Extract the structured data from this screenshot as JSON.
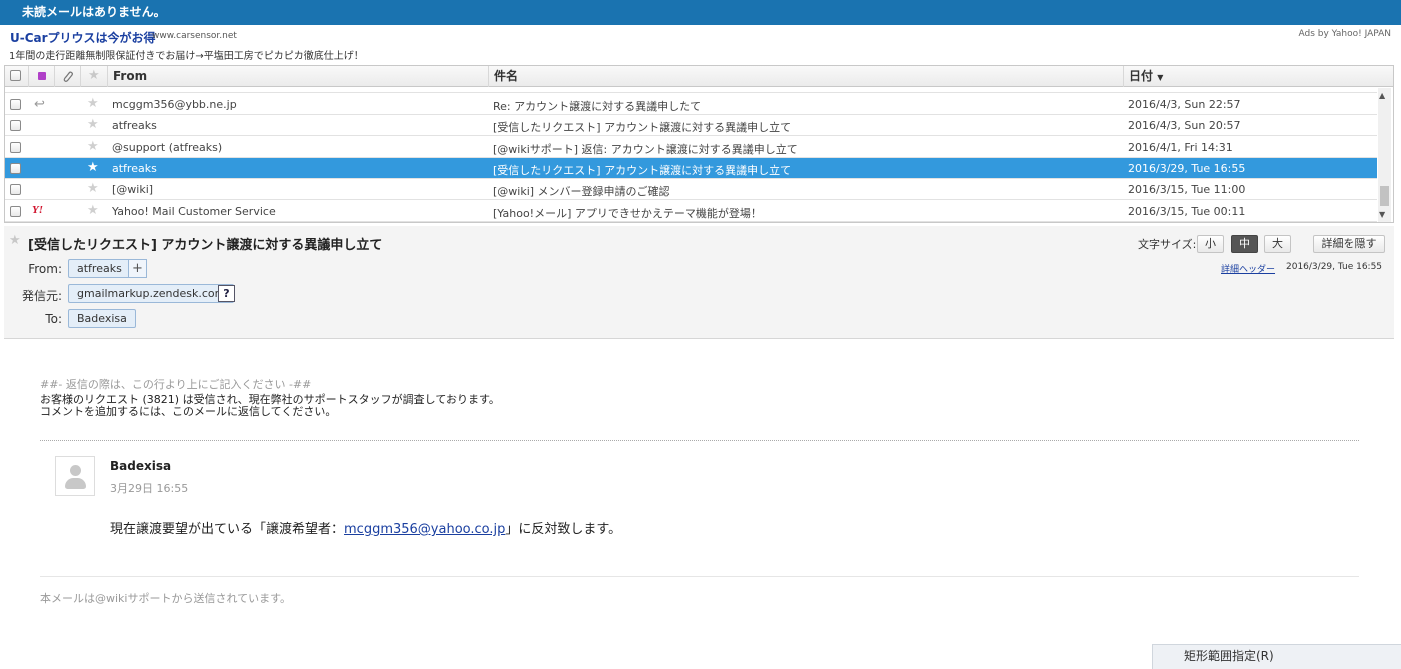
{
  "topbar": {
    "notice": "未読メールはありません。"
  },
  "ad": {
    "title": "U-Carプリウスは今がお得",
    "url": "www.carsensor.net",
    "description": "1年間の走行距離無制限保証付きでお届け→平塩田工房でピカピカ徹底仕上げ！",
    "ads_by": "Ads by Yahoo! JAPAN"
  },
  "list": {
    "columns": {
      "from": "From",
      "subject": "件名",
      "date": "日付",
      "sort_indicator": "▼"
    },
    "rows": [
      {
        "from": "mcggm356@ybb.ne.jp",
        "subject": "Re: アカウント譲渡に対する異議申したて",
        "date": "2016/4/3, Sun 22:57",
        "icon": "reply-icon",
        "selected": false
      },
      {
        "from": "atfreaks",
        "subject": "[受信したリクエスト] アカウント譲渡に対する異議申し立て",
        "date": "2016/4/3, Sun 20:57",
        "icon": "",
        "selected": false
      },
      {
        "from": "@support (atfreaks)",
        "subject": "[@wikiサポート] 返信: アカウント譲渡に対する異議申し立て",
        "date": "2016/4/1, Fri 14:31",
        "icon": "",
        "selected": false
      },
      {
        "from": "atfreaks",
        "subject": "[受信したリクエスト] アカウント譲渡に対する異議申し立て",
        "date": "2016/3/29, Tue 16:55",
        "icon": "",
        "selected": true
      },
      {
        "from": "[@wiki]",
        "subject": "[@wiki] メンバー登録申請のご確認",
        "date": "2016/3/15, Tue 11:00",
        "icon": "",
        "selected": false
      },
      {
        "from": "Yahoo! Mail Customer Service",
        "subject": "[Yahoo!メール] アプリできせかえテーマ機能が登場！",
        "date": "2016/3/15, Tue 00:11",
        "icon": "yahoo-icon",
        "selected": false
      }
    ]
  },
  "message": {
    "subject": "[受信したリクエスト] アカウント譲渡に対する異議申し立て",
    "from_label": "From:",
    "from_value": "atfreaks",
    "add_label": "+",
    "sender_label": "発信元:",
    "sender_value": "gmailmarkup.zendesk.com",
    "help_label": "?",
    "to_label": "To:",
    "to_value": "Badexisa",
    "font_size_label": "文字サイズ:",
    "font_small": "小",
    "font_medium": "中",
    "font_large": "大",
    "hide_details": "詳細を隠す",
    "detail_header_link": "詳細ヘッダー",
    "date": "2016/3/29, Tue 16:55"
  },
  "body": {
    "reply_marker": "##- 返信の際は、この行より上にご記入ください -##",
    "line1": "お客様のリクエスト (3821) は受信され、現在弊社のサポートスタッフが調査しております。",
    "line2": "コメントを追加するには、このメールに返信してください。",
    "comment_author": "Badexisa",
    "comment_date": "3月29日 16:55",
    "comment_before": "現在譲渡要望が出ている「譲渡希望者：",
    "comment_email": "mcggm356@yahoo.co.jp",
    "comment_after": "」に反対致します。",
    "footer": "本メールは@wikiサポートから送信されています。"
  },
  "rect_select": "矩形範囲指定(R)",
  "colors": {
    "topbar": "#1a73b0",
    "selected_row": "#3399dd",
    "link": "#1a3fa0"
  }
}
